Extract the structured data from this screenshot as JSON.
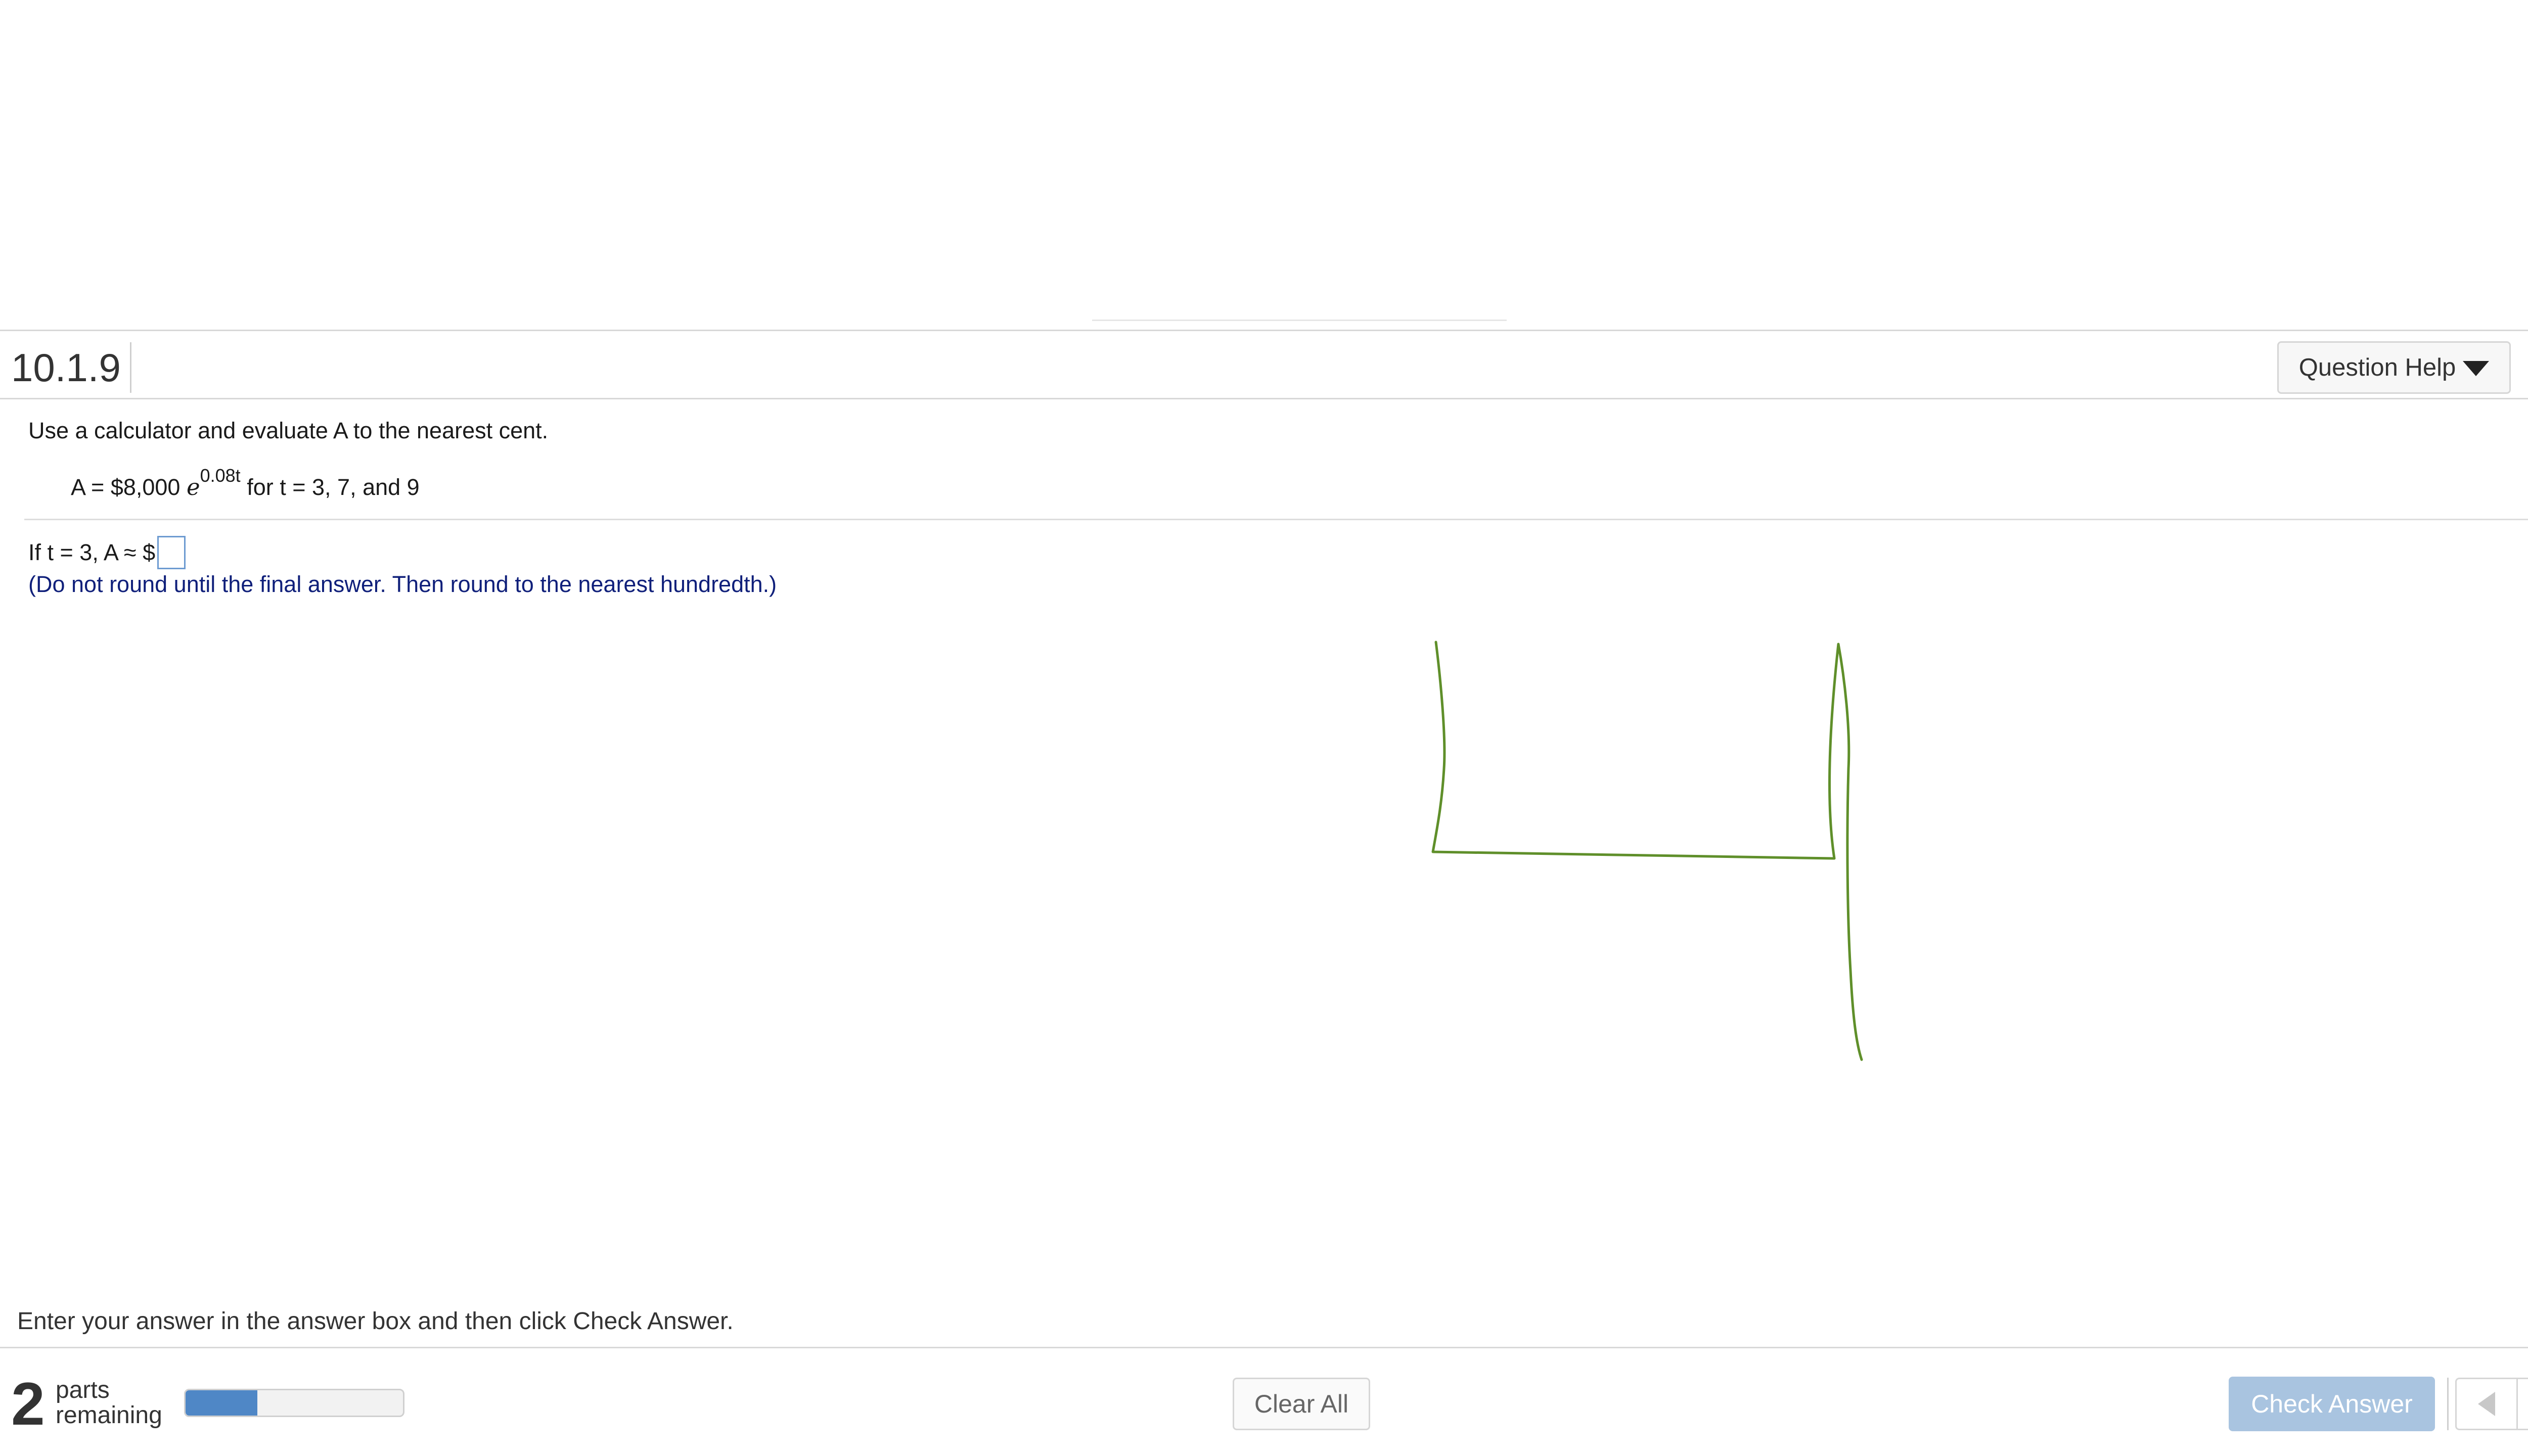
{
  "header": {
    "question_number": "10.1.9",
    "question_help_label": "Question Help"
  },
  "question": {
    "instruction": "Use a calculator and evaluate A to the nearest cent.",
    "formula": {
      "prefix": "A = $8,000",
      "base": "e",
      "exponent": "0.08t",
      "suffix": "for t = 3, 7, and 9"
    },
    "answer_prompt": {
      "prefix": "If t = 3, A ≈ $",
      "value": ""
    },
    "hint": "(Do not round until the final answer. Then round to the nearest hundredth.)"
  },
  "footer_message": "Enter your answer in the answer box and then click Check Answer.",
  "help_symbol": "?",
  "footer": {
    "parts_count": "2",
    "parts_line1": "parts",
    "parts_line2": "remaining",
    "progress_fraction": 0.33,
    "clear_all_label": "Clear All",
    "check_answer_label": "Check Answer"
  },
  "colors": {
    "progress_fill": "#4f87c6",
    "check_answer_bg": "#a9c4e0",
    "hint_text": "#0f1f7a",
    "scribble_stroke": "#5f8f2a",
    "help_circle": "#f5c54b"
  },
  "icons": {
    "settings": "gear-icon",
    "dropdown": "caret-down-icon",
    "help": "help-circle-icon",
    "previous": "arrow-left-icon",
    "next": "arrow-right-icon"
  }
}
